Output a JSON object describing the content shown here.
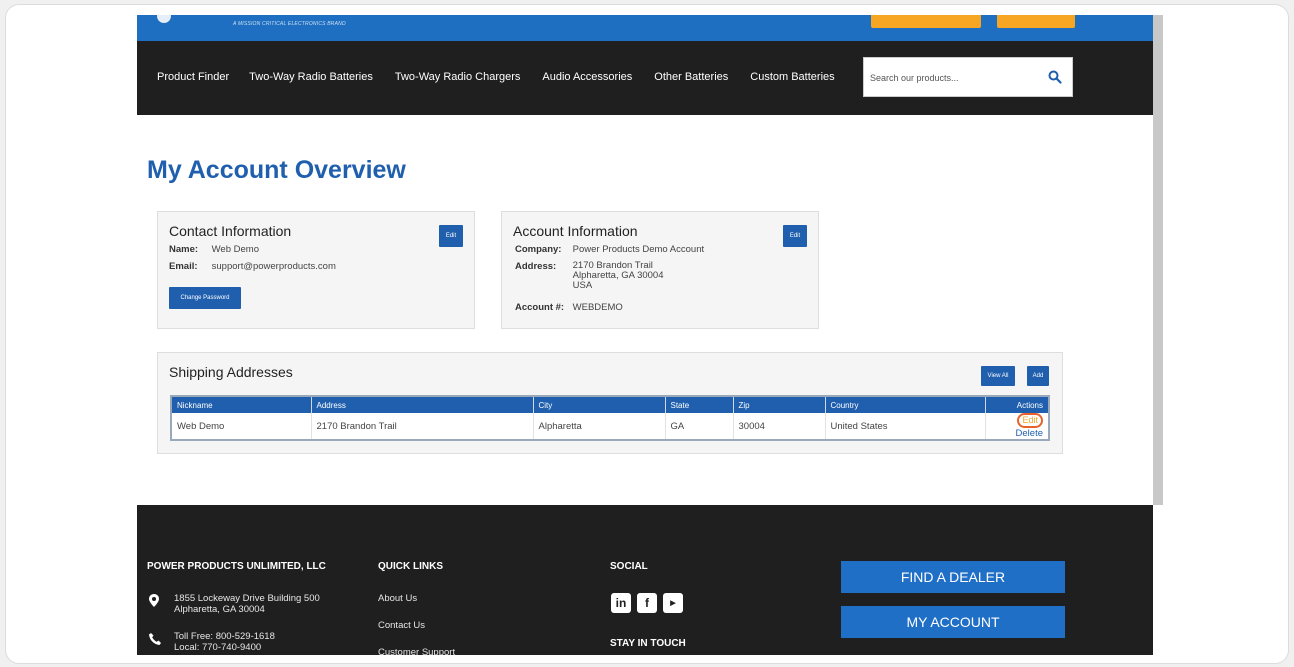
{
  "header": {
    "tagline": "A MISSION CRITICAL ELECTRONICS BRAND"
  },
  "nav": {
    "items": [
      "Product Finder",
      "Two-Way Radio Batteries",
      "Two-Way Radio Chargers",
      "Audio Accessories",
      "Other Batteries",
      "Custom Batteries"
    ],
    "search_placeholder": "Search our products..."
  },
  "page": {
    "title": "My Account Overview"
  },
  "contact": {
    "heading": "Contact Information",
    "edit_label": "Edit",
    "name_label": "Name:",
    "name_value": "Web Demo",
    "email_label": "Email:",
    "email_value": "support@powerproducts.com",
    "change_password_label": "Change Password"
  },
  "account": {
    "heading": "Account Information",
    "edit_label": "Edit",
    "company_label": "Company:",
    "company_value": "Power Products Demo Account",
    "address_label": "Address:",
    "address_line1": "2170 Brandon Trail",
    "address_line2": "Alpharetta, GA 30004",
    "address_line3": "USA",
    "account_label": "Account #:",
    "account_value": "WEBDEMO"
  },
  "shipping": {
    "heading": "Shipping Addresses",
    "view_all_label": "View All",
    "add_label": "Add",
    "columns": [
      "Nickname",
      "Address",
      "City",
      "State",
      "Zip",
      "Country",
      "Actions"
    ],
    "rows": [
      {
        "nickname": "Web Demo",
        "address": "2170 Brandon Trail",
        "city": "Alpharetta",
        "state": "GA",
        "zip": "30004",
        "country": "United States",
        "edit": "Edit",
        "delete": "Delete"
      }
    ]
  },
  "footer": {
    "company_heading": "POWER PRODUCTS UNLIMITED, LLC",
    "address_line1": "1855 Lockeway Drive Building 500",
    "address_line2": "Alpharetta, GA 30004",
    "phone_line1": "Toll Free: 800-529-1618",
    "phone_line2": "Local: 770-740-9400",
    "quick_links_heading": "QUICK LINKS",
    "quick_links": [
      "About Us",
      "Contact Us",
      "Customer Support"
    ],
    "social_heading": "SOCIAL",
    "stay_heading": "STAY IN TOUCH",
    "find_dealer_label": "FIND A DEALER",
    "my_account_label": "MY ACCOUNT"
  },
  "colors": {
    "brand_blue": "#1f5fae",
    "accent_orange": "#f6a623",
    "dark": "#1f1f1f"
  }
}
